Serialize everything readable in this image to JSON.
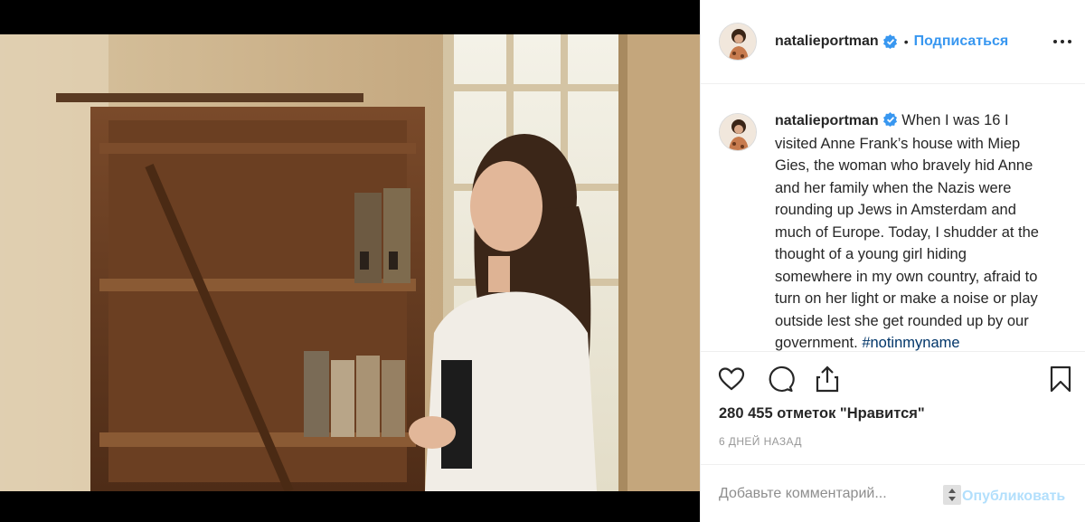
{
  "post": {
    "username": "natalieportman",
    "dot": "•",
    "follow_label": "Подписаться",
    "caption_username": "natalieportman",
    "caption_text": "When I was 16 I visited Anne Frank’s house with Miep Gies, the woman who bravely hid Anne and her family when the Nazis were rounding up Jews in Amsterdam and much of Europe. Today, I shudder at the thought of a young girl hiding somewhere in my own country, afraid to turn on her light or make a noise or play outside lest she get rounded up by our government.",
    "hashtag": "#notinmyname",
    "likes": "280 455 отметок \"Нравится\"",
    "time_ago": "6 ДНЕЙ НАЗАД"
  },
  "comment": {
    "placeholder": "Добавьте комментарий...",
    "publish_label": "Опубликовать"
  },
  "icons": {
    "verified": "verified-badge-icon",
    "more": "more-options-icon",
    "like": "heart-icon",
    "comment": "comment-icon",
    "share": "share-icon",
    "save": "bookmark-icon"
  },
  "colors": {
    "link": "#3897f0",
    "hashtag": "#003569",
    "publish_disabled": "#b2dffc",
    "muted": "#999999"
  }
}
